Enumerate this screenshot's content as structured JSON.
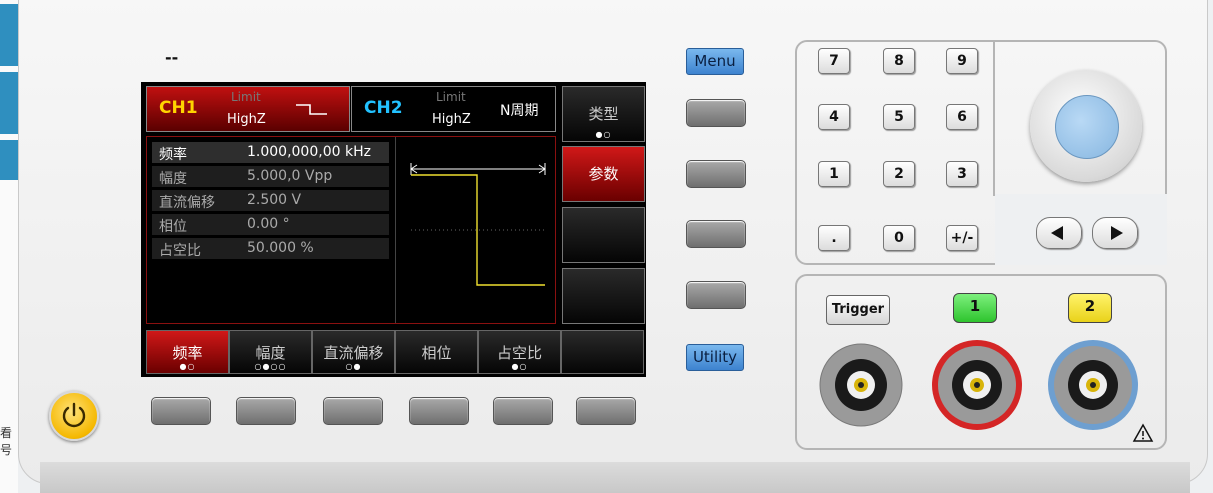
{
  "app": {
    "title": "--",
    "side_text": "看号"
  },
  "screen": {
    "ch1": {
      "label": "CH1",
      "limit": "Limit",
      "impedance": "HighZ",
      "wave_icon": "square-wave-icon"
    },
    "ch2": {
      "label": "CH2",
      "limit": "Limit",
      "impedance": "HighZ",
      "mode": "N周期"
    },
    "side_menu": [
      {
        "label": "类型",
        "dots": "●○"
      },
      {
        "label": "参数",
        "dots": ""
      },
      {
        "label": "",
        "dots": ""
      },
      {
        "label": "",
        "dots": ""
      }
    ],
    "params": [
      {
        "name": "频率",
        "value": "1.000,000,00 kHz"
      },
      {
        "name": "幅度",
        "value": "5.000,0 Vpp"
      },
      {
        "name": "直流偏移",
        "value": "2.500 V"
      },
      {
        "name": "相位",
        "value": "0.00 °"
      },
      {
        "name": "占空比",
        "value": "50.000 %"
      }
    ],
    "bottom_menu": [
      {
        "label": "频率",
        "dots": "●○"
      },
      {
        "label": "幅度",
        "dots": "○●○○"
      },
      {
        "label": "直流偏移",
        "dots": "○●"
      },
      {
        "label": "相位",
        "dots": ""
      },
      {
        "label": "占空比",
        "dots": "●○"
      },
      {
        "label": "",
        "dots": ""
      }
    ]
  },
  "buttons": {
    "menu": "Menu",
    "utility": "Utility"
  },
  "numpad": {
    "keys": [
      "7",
      "8",
      "9",
      "4",
      "5",
      "6",
      "1",
      "2",
      "3",
      ".",
      "0",
      "+/-"
    ]
  },
  "outputs": {
    "trigger": "Trigger",
    "ch1": "1",
    "ch2": "2",
    "warning_icon": "warning-triangle-icon"
  },
  "colors": {
    "ch1": "#ffd400",
    "ch2": "#22c2ff",
    "active": "#d01818",
    "ch1_button": "#3ed33e",
    "ch2_button": "#f2e12a"
  }
}
